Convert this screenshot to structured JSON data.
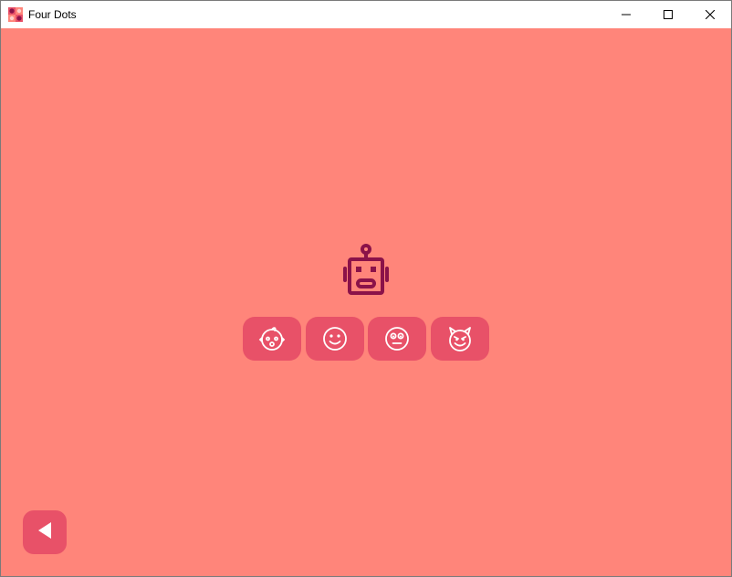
{
  "window": {
    "title": "Four Dots",
    "app_icon": "four-dots-app-icon",
    "controls": [
      "minimize-icon",
      "maximize-icon",
      "close-icon"
    ]
  },
  "colors": {
    "background": "#ff857a",
    "button": "#e85168",
    "robot": "#8b1249",
    "icon_stroke": "#ffffff"
  },
  "main": {
    "opponent_icon": "robot-icon",
    "difficulty_options": [
      {
        "id": "baby",
        "icon": "baby-face-icon"
      },
      {
        "id": "smile",
        "icon": "smiling-face-icon"
      },
      {
        "id": "worried",
        "icon": "worried-face-icon"
      },
      {
        "id": "devil",
        "icon": "devil-face-icon"
      }
    ]
  },
  "footer": {
    "back_icon": "back-arrow-icon"
  }
}
